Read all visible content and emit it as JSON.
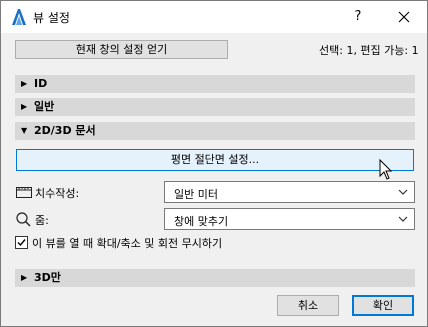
{
  "window": {
    "title": "뷰 설정",
    "help_label": "?",
    "close_icon": "close-icon",
    "app_icon": "archicad-icon"
  },
  "top": {
    "load_button": "현재 창의 설정 얻기",
    "selection_info": "선택: 1, 편집 가능: 1"
  },
  "sections": {
    "id": {
      "label": "ID",
      "expanded": false
    },
    "general": {
      "label": "일반",
      "expanded": false
    },
    "doc2d3d": {
      "label": "2D/3D 문서",
      "expanded": true
    },
    "only3d": {
      "label": "3D만",
      "expanded": false
    }
  },
  "doc": {
    "cut_plane_button": "평면 절단면 설정...",
    "dimension_label": "치수작성:",
    "dimension_value": "일반 미터",
    "zoom_label": "줌:",
    "zoom_value": "창에 맞추기",
    "ignore_label": "이 뷰를 열 때 확대/축소 및 회전 무시하기",
    "ignore_checked": true
  },
  "footer": {
    "cancel": "취소",
    "ok": "확인"
  }
}
